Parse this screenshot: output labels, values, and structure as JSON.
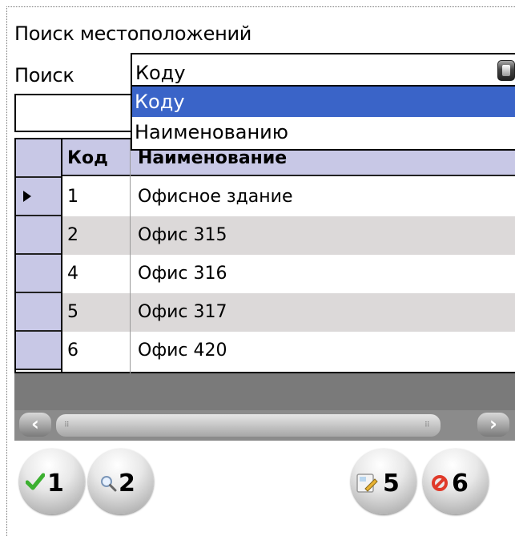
{
  "title": "Поиск местоположений",
  "search": {
    "label": "Поиск",
    "selected": "Коду",
    "options": [
      "Коду",
      "Наименованию"
    ],
    "input_value": ""
  },
  "table": {
    "columns": [
      "Код",
      "Наименование"
    ],
    "rows": [
      {
        "code": "1",
        "name": "Офисное здание"
      },
      {
        "code": "2",
        "name": "Офис 315"
      },
      {
        "code": "4",
        "name": "Офис 316"
      },
      {
        "code": "5",
        "name": "Офис 317"
      },
      {
        "code": "6",
        "name": "Офис 420"
      }
    ]
  },
  "buttons": [
    {
      "num": "1",
      "icon": "check-icon"
    },
    {
      "num": "2",
      "icon": "magnifier-icon"
    },
    {
      "num": "5",
      "icon": "edit-document-icon"
    },
    {
      "num": "6",
      "icon": "cancel-icon"
    }
  ],
  "colors": {
    "selection": "#3a64c8",
    "header": "#c8c8e6",
    "alt_row": "#dcd9d9"
  }
}
